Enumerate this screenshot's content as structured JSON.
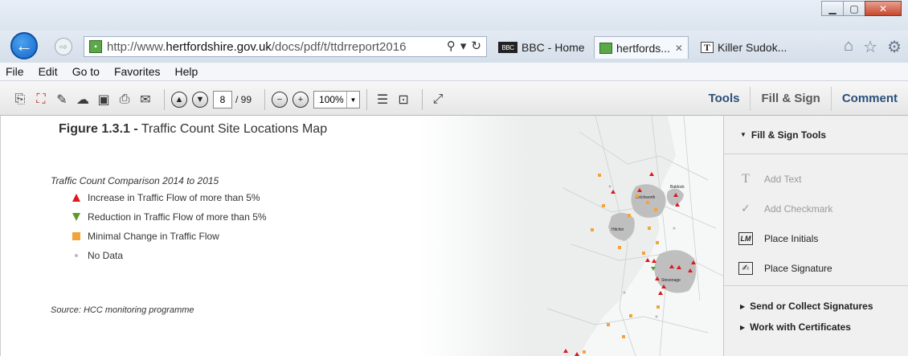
{
  "browser": {
    "url_prefix": "http://www.",
    "url_domain": "hertfordshire.gov.uk",
    "url_path": "/docs/pdf/t/ttdrreport2016",
    "tabs": [
      {
        "label": "BBC - Home",
        "icon": "bbc-icon",
        "icon_text": "BBC"
      },
      {
        "label": "hertfords...",
        "icon": "pdf-icon",
        "active": true
      },
      {
        "label": "Killer Sudok...",
        "icon": "nyt-icon",
        "icon_text": "T"
      }
    ],
    "menu": [
      "File",
      "Edit",
      "Go to",
      "Favorites",
      "Help"
    ]
  },
  "pdf_toolbar": {
    "page_current": "8",
    "page_total": "/ 99",
    "zoom": "100%",
    "links": [
      "Tools",
      "Fill & Sign",
      "Comment"
    ]
  },
  "document": {
    "figure_label": "Figure 1.3.1 -",
    "figure_title": "Traffic Count Site Locations Map",
    "legend_title": "Traffic Count Comparison 2014 to 2015",
    "legend": [
      {
        "label": "Increase in Traffic Flow of more than 5%",
        "marker": "triangle-up",
        "color": "#e0161a"
      },
      {
        "label": "Reduction in Traffic Flow of more than 5%",
        "marker": "triangle-down",
        "color": "#5c9a2c"
      },
      {
        "label": "Minimal Change in Traffic Flow",
        "marker": "square",
        "color": "#f2a33a"
      },
      {
        "label": "No Data",
        "marker": "dot",
        "color": "#bbbbbb"
      }
    ],
    "source": "Source: HCC monitoring programme",
    "map_labels": [
      "Baldock",
      "Letchworth",
      "Hitchin",
      "Stevenage"
    ]
  },
  "panel": {
    "header": "Fill & Sign Tools",
    "tools": [
      {
        "label": "Add Text",
        "icon": "text-icon",
        "glyph": "T",
        "disabled": true
      },
      {
        "label": "Add Checkmark",
        "icon": "checkmark-icon",
        "glyph": "✓",
        "disabled": true
      },
      {
        "label": "Place Initials",
        "icon": "initials-icon",
        "glyph": "LM",
        "disabled": false
      },
      {
        "label": "Place Signature",
        "icon": "signature-icon",
        "glyph": "✍",
        "disabled": false
      }
    ],
    "sections": [
      "Send or Collect Signatures",
      "Work with Certificates"
    ]
  }
}
